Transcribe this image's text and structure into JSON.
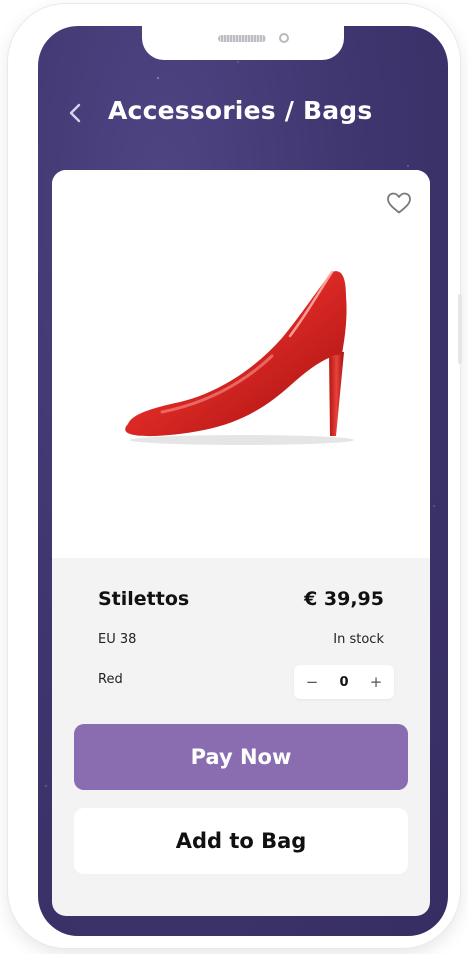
{
  "header": {
    "title": "Accessories / Bags",
    "back_icon": "chevron-left-icon"
  },
  "product": {
    "name": "Stilettos",
    "price": "€ 39,95",
    "size": "EU 38",
    "stock_status": "In stock",
    "color": "Red",
    "image_icon": "red-stiletto-shoe",
    "favorite_icon": "heart-outline-icon"
  },
  "quantity": {
    "decrement_label": "−",
    "value": "0",
    "increment_label": "+"
  },
  "actions": {
    "pay_label": "Pay Now",
    "add_label": "Add to Bag"
  },
  "colors": {
    "background": "#3d3370",
    "accent": "#8a6db1",
    "card": "#f3f3f3",
    "shoe": "#d32421"
  }
}
